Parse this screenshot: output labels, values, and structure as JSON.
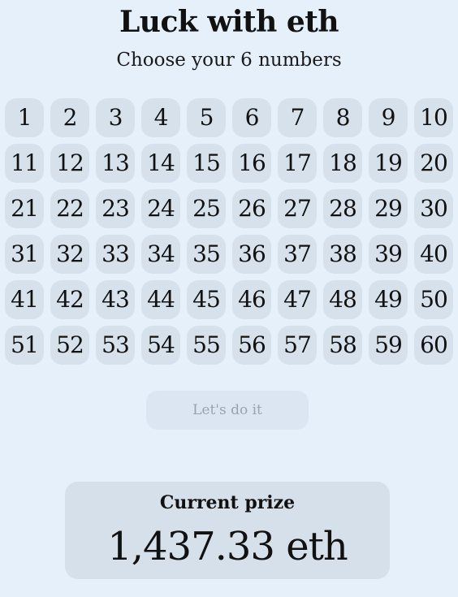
{
  "header": {
    "title": "Luck with eth",
    "subtitle": "Choose your 6 numbers"
  },
  "numbers": [
    "1",
    "2",
    "3",
    "4",
    "5",
    "6",
    "7",
    "8",
    "9",
    "10",
    "11",
    "12",
    "13",
    "14",
    "15",
    "16",
    "17",
    "18",
    "19",
    "20",
    "21",
    "22",
    "23",
    "24",
    "25",
    "26",
    "27",
    "28",
    "29",
    "30",
    "31",
    "32",
    "33",
    "34",
    "35",
    "36",
    "37",
    "38",
    "39",
    "40",
    "41",
    "42",
    "43",
    "44",
    "45",
    "46",
    "47",
    "48",
    "49",
    "50",
    "51",
    "52",
    "53",
    "54",
    "55",
    "56",
    "57",
    "58",
    "59",
    "60"
  ],
  "action": {
    "submit_label": "Let's do it"
  },
  "prize": {
    "label": "Current prize",
    "value": "1,437.33 eth"
  }
}
